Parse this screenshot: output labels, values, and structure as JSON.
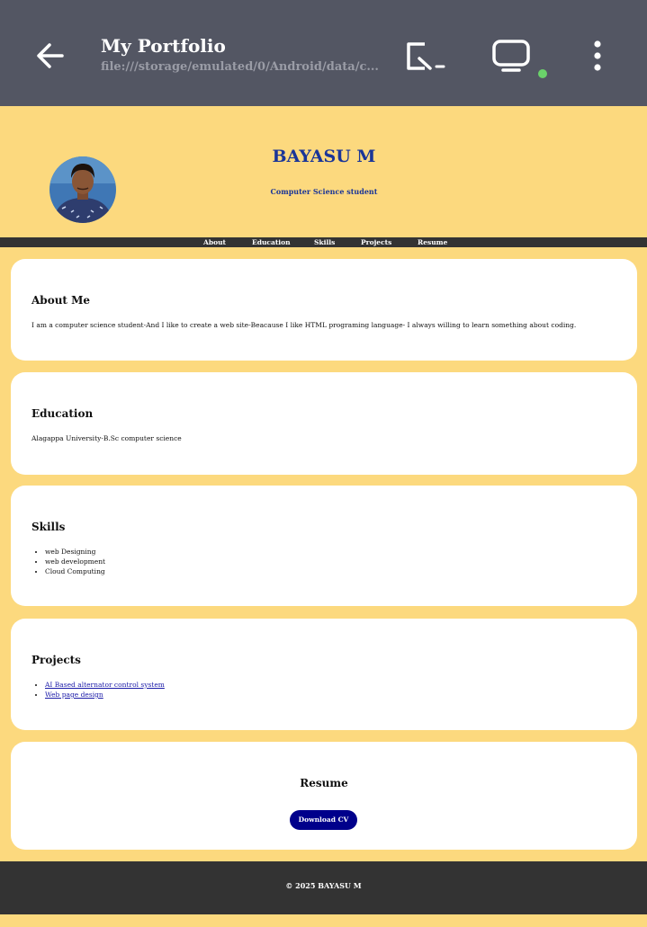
{
  "appbar": {
    "title": "My Portfolio",
    "url": "file:///storage/emulated/0/Android/data/c...",
    "icons": [
      "back-arrow-icon",
      "screen-mirror-icon",
      "monitor-icon",
      "more-vert-icon"
    ],
    "color": "#535663"
  },
  "header": {
    "name": "BAYASU M",
    "subtitle": "Computer Science student",
    "accent": "#1a3598"
  },
  "nav": {
    "items": [
      "About",
      "Education",
      "Skills",
      "Projects",
      "Resume"
    ]
  },
  "about": {
    "heading": "About Me",
    "text": "I am a computer science student-And I like to create a web site-Beacause I like HTML programing language- I always willing to learn something about coding."
  },
  "education": {
    "heading": "Education",
    "text": "Alagappa University-B.Sc computer science"
  },
  "skills": {
    "heading": "Skills",
    "items": [
      "web Designing",
      "web development",
      "Cloud Computing"
    ]
  },
  "projects": {
    "heading": "Projects",
    "items": [
      "AI Based alternator control system",
      "Web page design"
    ]
  },
  "resume": {
    "heading": "Resume",
    "button": "Download CV"
  },
  "footer": {
    "text": "© 2025 BAYASU M"
  },
  "colors": {
    "background": "#fcd97e",
    "nav": "#333333",
    "button": "#00008b"
  }
}
